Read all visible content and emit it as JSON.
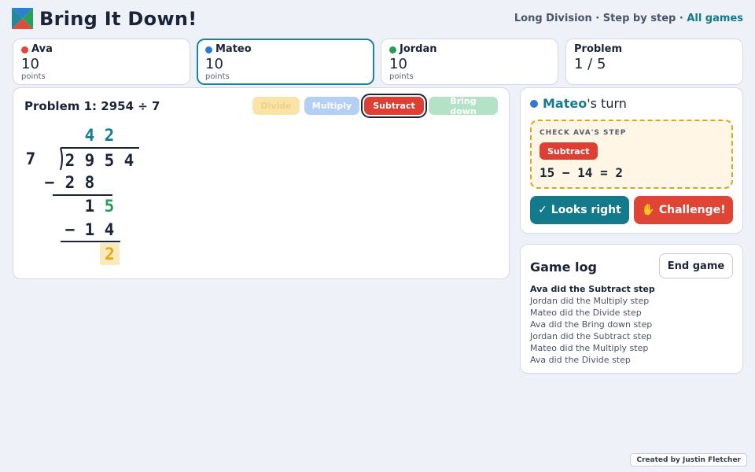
{
  "app": {
    "title": "Bring It Down!",
    "subtitle_prefix": "Long Division · Step by step · ",
    "all_games_link": "All games"
  },
  "players": [
    {
      "name": "Ava",
      "score": "10",
      "unit": "points",
      "color": "#e0443a"
    },
    {
      "name": "Mateo",
      "score": "10",
      "unit": "points",
      "color": "#3277d6"
    },
    {
      "name": "Jordan",
      "score": "10",
      "unit": "points",
      "color": "#2a9b57"
    }
  ],
  "problem_card": {
    "label": "Problem",
    "value": "1 / 5"
  },
  "problem": {
    "title": "Problem 1: 2954 ÷ 7",
    "steps": [
      "Divide",
      "Multiply",
      "Subtract",
      "Bring down"
    ],
    "divisor": "7",
    "dividend": [
      "2",
      "9",
      "5",
      "4"
    ],
    "quotient": [
      "4",
      "2"
    ],
    "work": {
      "sub1_minus": "−",
      "sub1": [
        "2",
        "8"
      ],
      "rem1": [
        "1",
        "5"
      ],
      "sub2_minus": "−",
      "sub2": [
        "1",
        "4"
      ],
      "rem2": [
        "2"
      ]
    }
  },
  "turn": {
    "player": "Mateo",
    "suffix": "'s turn",
    "check_label": "CHECK AVA'S STEP",
    "step_badge": "Subtract",
    "equation": "15 − 14 = 2",
    "looks_right": "✓ Looks right",
    "challenge": "✋ Challenge!"
  },
  "log": {
    "title": "Game log",
    "end_game": "End game",
    "entries": [
      "Ava did the Subtract step",
      "Jordan did the Multiply step",
      "Mateo did the Divide step",
      "Ava did the Bring down step",
      "Jordan did the Subtract step",
      "Mateo did the Multiply step",
      "Ava did the Divide step"
    ]
  },
  "credit": "Created by Justin Fletcher",
  "colors": {
    "accent_teal": "#137a8c",
    "subtract_red": "#dd3f35",
    "check_border": "#d9a620"
  }
}
